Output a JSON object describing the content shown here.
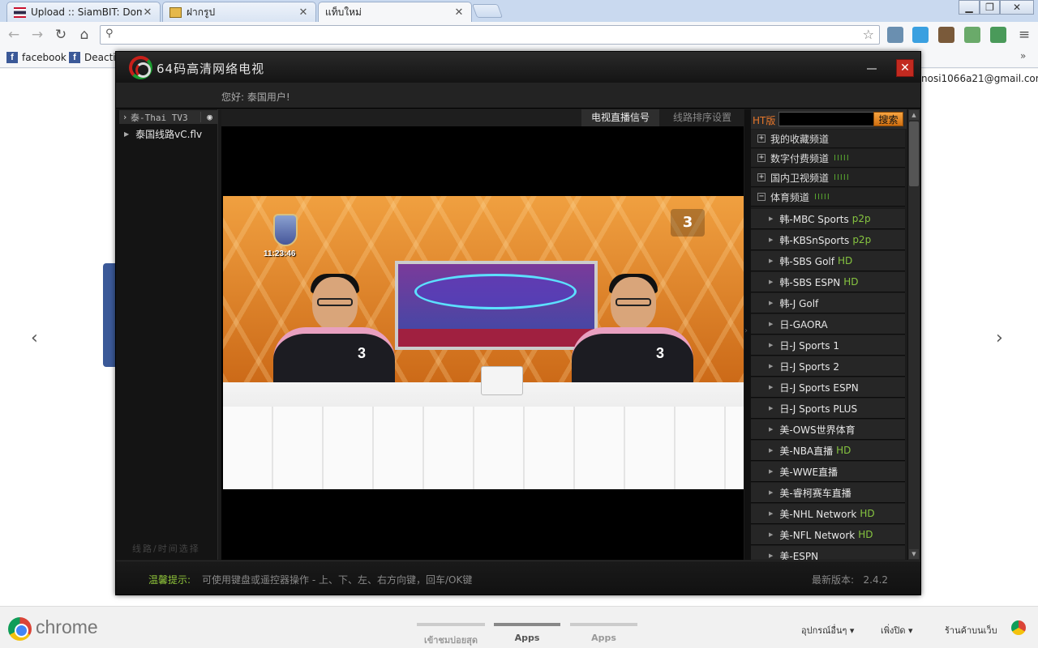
{
  "browser": {
    "tabs": [
      {
        "title": "Upload :: SiamBIT: Domains T"
      },
      {
        "title": "ฝากรูป"
      },
      {
        "title": "แท็บใหม่"
      }
    ],
    "bookmarks": [
      {
        "label": "facebook"
      },
      {
        "label": "Deactiv"
      }
    ],
    "account_email": "nosi1066a21@gmail.com"
  },
  "ntp": {
    "brand": "chrome",
    "tabs": [
      "เข้าชมบ่อยสุด",
      "Apps",
      "Apps"
    ],
    "right_links": [
      "อุปกรณ์อื่นๆ",
      "เพิ่งปิด",
      "ร้านค้าบนเว็บ"
    ],
    "prev_arrow": "‹",
    "next_arrow": "›"
  },
  "tv": {
    "title": "64码高清网络电视",
    "greeting": "您好: 泰国用户!",
    "channel_header": "泰-Thai TV3",
    "lines": [
      "泰国线路vC.flv"
    ],
    "left_footer": "线路/时间选择",
    "center_tabs": [
      "电视直播信号",
      "线路排序设置"
    ],
    "video": {
      "clock": "11:23:46",
      "channel_number": "3",
      "host_number": "3"
    },
    "search": {
      "prefix": "HT版",
      "value": "",
      "button": "搜索"
    },
    "categories": [
      {
        "label": "我的收藏频道",
        "expanded": false,
        "bars": ""
      },
      {
        "label": "数字付费频道",
        "expanded": false,
        "bars": "IIIII"
      },
      {
        "label": "国内卫视频道",
        "expanded": false,
        "bars": "IIIII"
      },
      {
        "label": "体育频道",
        "expanded": true,
        "bars": "IIIII"
      }
    ],
    "channels": [
      {
        "name": "韩-MBC Sports",
        "tag": "p2p"
      },
      {
        "name": "韩-KBSnSports",
        "tag": "p2p"
      },
      {
        "name": "韩-SBS Golf",
        "tag": "HD"
      },
      {
        "name": "韩-SBS ESPN",
        "tag": "HD"
      },
      {
        "name": "韩-J Golf",
        "tag": ""
      },
      {
        "name": "日-GAORA",
        "tag": ""
      },
      {
        "name": "日-J Sports 1",
        "tag": ""
      },
      {
        "name": "日-J Sports 2",
        "tag": ""
      },
      {
        "name": "日-J Sports ESPN",
        "tag": ""
      },
      {
        "name": "日-J Sports PLUS",
        "tag": ""
      },
      {
        "name": "美-OWS世界体育",
        "tag": ""
      },
      {
        "name": "美-NBA直播",
        "tag": "HD"
      },
      {
        "name": "美-WWE直播",
        "tag": ""
      },
      {
        "name": "美-睿柯赛车直播",
        "tag": ""
      },
      {
        "name": "美-NHL Network",
        "tag": "HD"
      },
      {
        "name": "美-NFL Network",
        "tag": "HD"
      },
      {
        "name": "美-ESPN",
        "tag": ""
      }
    ],
    "status": {
      "tip_label": "温馨提示:",
      "tip_text": "可使用键盘或遥控器操作 - 上、下、左、右方向键，回车/OK键",
      "version_label": "最新版本:",
      "version": "2.4.2"
    }
  }
}
